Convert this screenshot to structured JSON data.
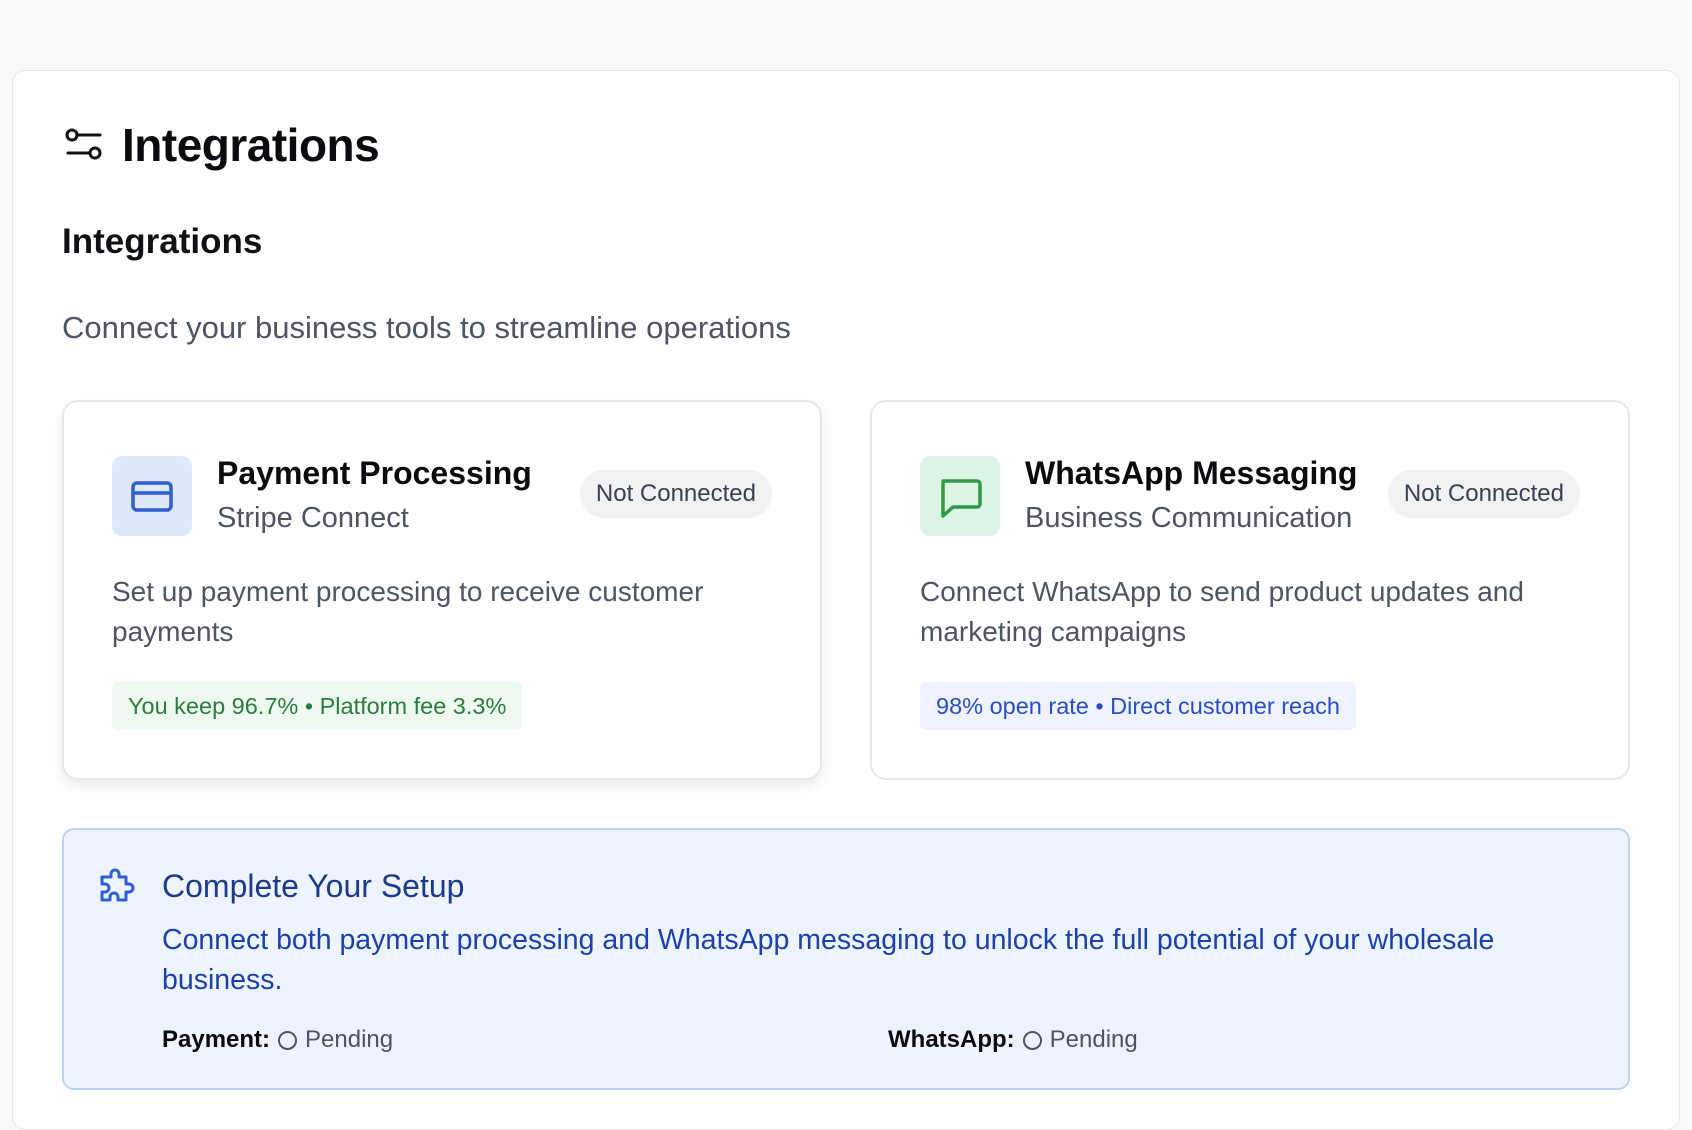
{
  "header": {
    "title": "Integrations",
    "icon": "sliders-icon"
  },
  "section": {
    "title": "Integrations",
    "description": "Connect your business tools to streamline operations"
  },
  "integrations": [
    {
      "name": "Payment Processing",
      "subtitle": "Stripe Connect",
      "status": "Not Connected",
      "description": "Set up payment processing to receive customer payments",
      "tag": "You keep 96.7% • Platform fee 3.3%",
      "icon": "credit-card-icon",
      "accent": "#2f5fd0"
    },
    {
      "name": "WhatsApp Messaging",
      "subtitle": "Business Communication",
      "status": "Not Connected",
      "description": "Connect WhatsApp to send product updates and marketing campaigns",
      "tag": "98% open rate • Direct customer reach",
      "icon": "message-square-icon",
      "accent": "#2f9a4b"
    }
  ],
  "setup": {
    "title": "Complete Your Setup",
    "text": "Connect both payment processing and WhatsApp messaging to unlock the full potential of your wholesale business.",
    "icon": "puzzle-icon",
    "statuses": [
      {
        "label": "Payment:",
        "value": "Pending"
      },
      {
        "label": "WhatsApp:",
        "value": "Pending"
      }
    ]
  },
  "colors": {
    "banner_bg": "#eef4fd",
    "banner_text": "#1d40af",
    "success_tag": "#2d7a3f",
    "info_tag": "#2a4dc4"
  }
}
